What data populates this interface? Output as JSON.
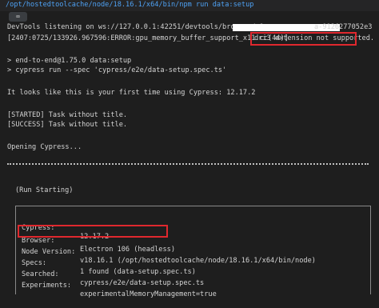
{
  "command_bar": {
    "command": "/opt/hostedtoolcache/node/18.16.1/x64/bin/npm run data:setup"
  },
  "tab": {
    "icon": "link-icon"
  },
  "terminal": {
    "devtools_prefix": "DevTools listening on ws://127.0.0.1:42251/devtools/browser/e9",
    "devtools_suffix": "a-9126277052e3",
    "error_line": "[2407:0725/133926.967596:ERROR:gpu_memory_buffer_support_x11.cc(44)]",
    "error_highlight": "dri3 extension not supported.",
    "npm_line1": "> end-to-end@1.75.0 data:setup",
    "npm_line2": "> cypress run --spec 'cypress/e2e/data-setup.spec.ts'",
    "first_time": "It looks like this is your first time using Cypress: 12.17.2",
    "started": "[STARTED] Task without title.",
    "success": "[SUCCESS] Task without title.",
    "opening": "Opening Cypress...",
    "run_starting": "(Run Starting)"
  },
  "run_table": {
    "rows": [
      {
        "key": "Cypress:",
        "value": "12.17.2"
      },
      {
        "key": "Browser:",
        "value": "Electron 106 (headless)"
      },
      {
        "key": "Node Version:",
        "value": "v18.16.1 (/opt/hostedtoolcache/node/18.16.1/x64/bin/node)"
      },
      {
        "key": "Specs:",
        "value": "1 found (data-setup.spec.ts)"
      },
      {
        "key": "Searched:",
        "value": "cypress/e2e/data-setup.spec.ts"
      },
      {
        "key": "Experiments:",
        "value": "experimentalMemoryManagement=true"
      }
    ]
  },
  "colors": {
    "highlight": "#e0282e",
    "command": "#4ea1f3",
    "background": "#1e1e1e"
  }
}
